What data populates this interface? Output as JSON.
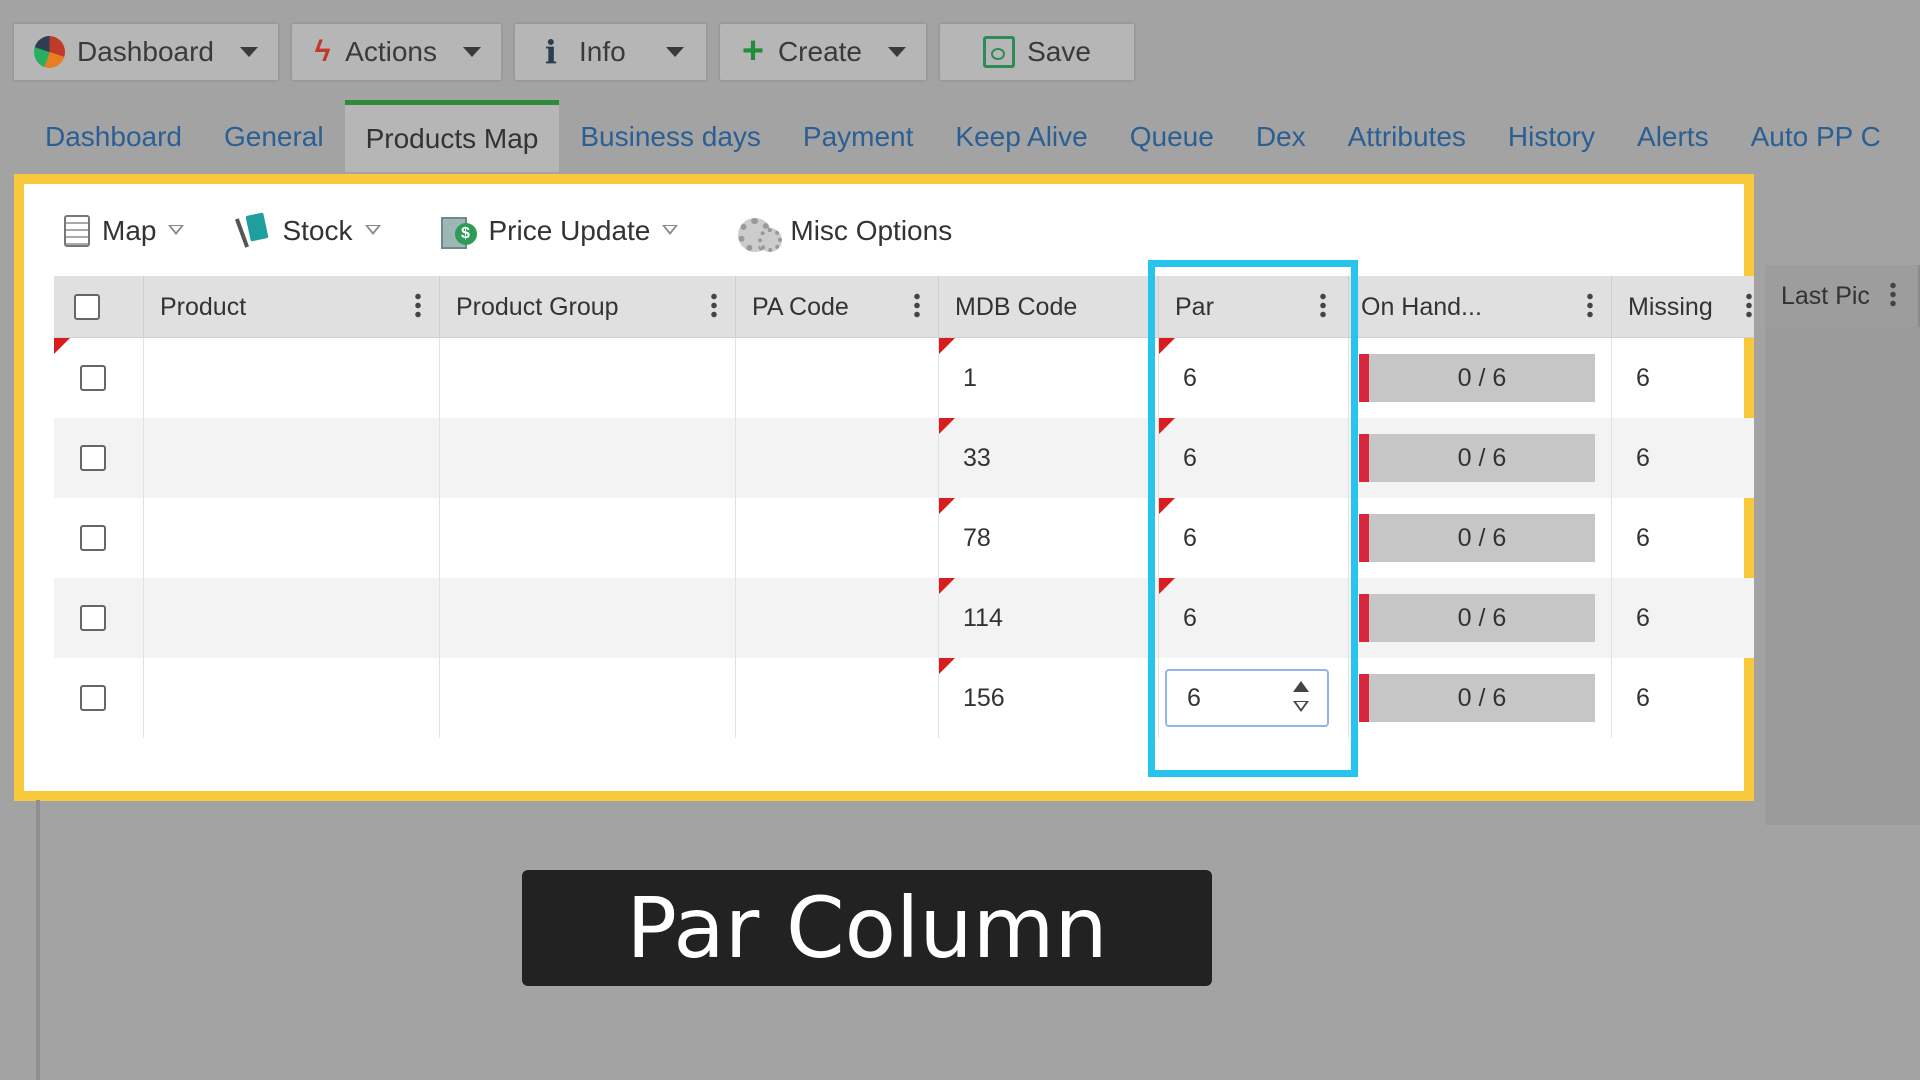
{
  "toolbar": {
    "dashboard": {
      "label": "Dashboard",
      "icon": "pie-chart-icon"
    },
    "actions": {
      "label": "Actions",
      "icon": "bolt-icon"
    },
    "info": {
      "label": "Info",
      "icon": "info-icon"
    },
    "create": {
      "label": "Create",
      "icon": "plus-icon"
    },
    "save": {
      "label": "Save",
      "icon": "floppy-disk-icon"
    }
  },
  "tabs": [
    {
      "label": "Dashboard"
    },
    {
      "label": "General"
    },
    {
      "label": "Products Map",
      "active": true
    },
    {
      "label": "Business days"
    },
    {
      "label": "Payment"
    },
    {
      "label": "Keep Alive"
    },
    {
      "label": "Queue"
    },
    {
      "label": "Dex"
    },
    {
      "label": "Attributes"
    },
    {
      "label": "History"
    },
    {
      "label": "Alerts"
    },
    {
      "label": "Auto PP C"
    }
  ],
  "subtoolbar": {
    "map": "Map",
    "stock": "Stock",
    "price_update": "Price Update",
    "misc_options": "Misc Options"
  },
  "grid": {
    "headers": {
      "product": "Product",
      "product_group": "Product Group",
      "pa_code": "PA Code",
      "mdb_code": "MDB Code",
      "par": "Par",
      "on_hand": "On Hand...",
      "missing": "Missing",
      "last_pic": "Last Pic"
    },
    "rows": [
      {
        "mdb_code": "1",
        "par": "6",
        "on_hand": "0 / 6",
        "missing": "6"
      },
      {
        "mdb_code": "33",
        "par": "6",
        "on_hand": "0 / 6",
        "missing": "6"
      },
      {
        "mdb_code": "78",
        "par": "6",
        "on_hand": "0 / 6",
        "missing": "6"
      },
      {
        "mdb_code": "114",
        "par": "6",
        "on_hand": "0 / 6",
        "missing": "6"
      },
      {
        "mdb_code": "156",
        "par": "6",
        "on_hand": "0 / 6",
        "missing": "6",
        "editing": true
      }
    ]
  },
  "caption": "Par Column",
  "colors": {
    "panel_highlight": "#f8c93a",
    "column_highlight": "#27c5ee",
    "dirty_flag": "#d91c1c",
    "stock_bar_marker": "#d7263d",
    "active_tab_border": "#2e8b3a",
    "tab_link": "#2b5f94"
  }
}
